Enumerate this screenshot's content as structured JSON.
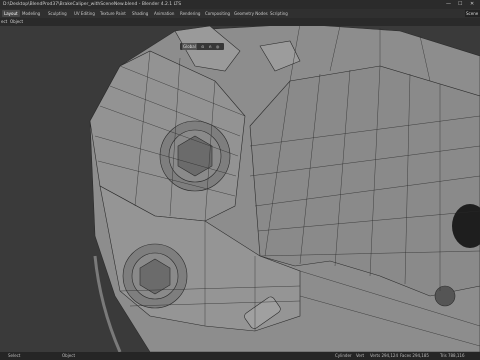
{
  "app": {
    "title": "D:\\Desktop\\BlendProd37\\BrakeCaliper_withSceneNew.blend - Blender 4.2.1 LTS",
    "window_controls": {
      "minimize": "—",
      "maximize": "☐",
      "close": "✕"
    }
  },
  "workspace_tabs": [
    "Layout",
    "Modeling",
    "Sculpting",
    "UV Editing",
    "Texture Paint",
    "Shading",
    "Animation",
    "Rendering",
    "Compositing",
    "Geometry Nodes",
    "Scripting"
  ],
  "active_tab": "Layout",
  "scene_field": "Scene",
  "header_menus": [
    "ect",
    "Object"
  ],
  "viewport_header": {
    "orientation": "Global",
    "pivot_icon": "pivot-icon",
    "snap_icon": "magnet-icon",
    "proportional_icon": "proportional-edit-icon"
  },
  "status": {
    "left": "Select",
    "middle": "Object",
    "right_items": [
      "Cylinder",
      "Vert",
      "Verts 294,124",
      "Faces 294,185",
      "Tris 788,116"
    ]
  },
  "colors": {
    "mesh_face": "#8e8e8e",
    "mesh_wire": "#2b2b2b",
    "background": "#3b3b3b",
    "active_tab": "#474747"
  }
}
